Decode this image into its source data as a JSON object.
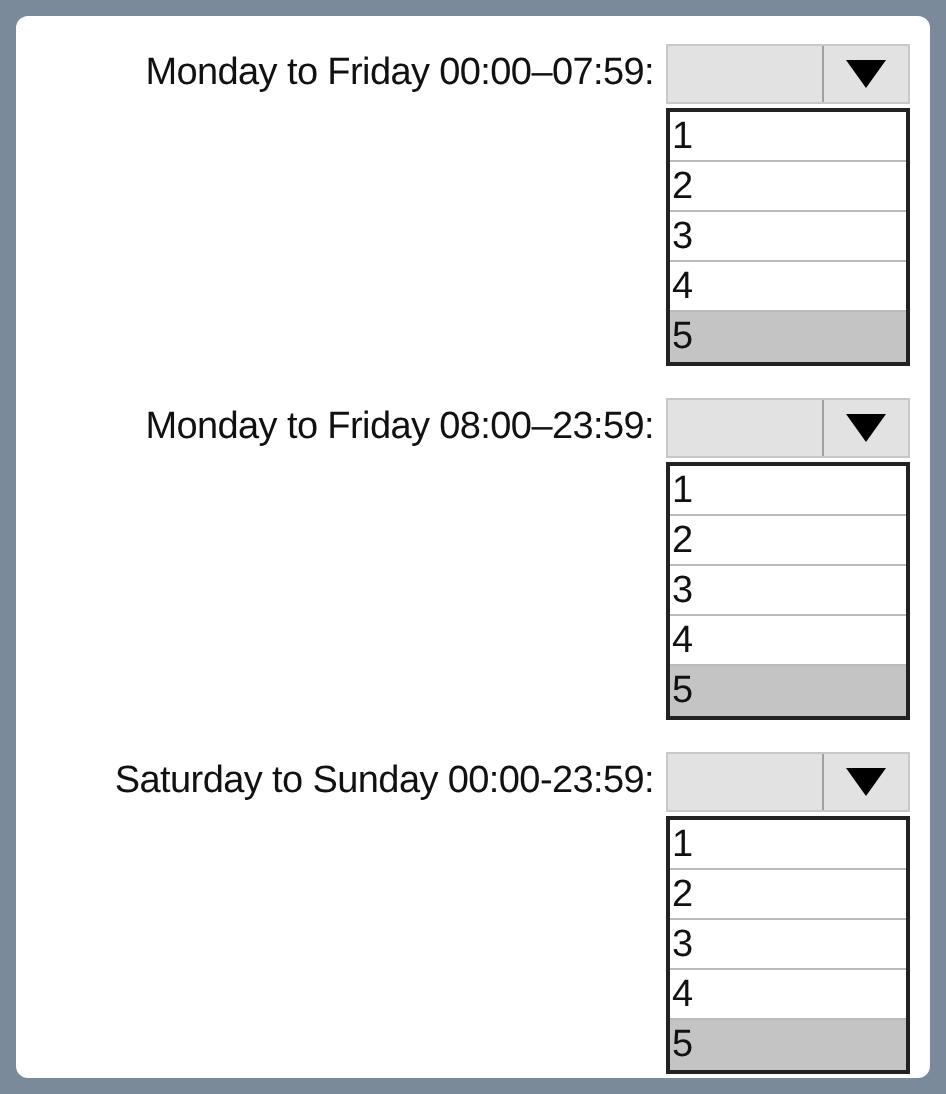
{
  "sections": [
    {
      "label": "Monday to Friday 00:00–07:59:",
      "options": [
        {
          "text": "1",
          "selected": false
        },
        {
          "text": "2",
          "selected": false
        },
        {
          "text": "3",
          "selected": false
        },
        {
          "text": "4",
          "selected": false
        },
        {
          "text": "5",
          "selected": true
        }
      ]
    },
    {
      "label": "Monday to Friday 08:00–23:59:",
      "options": [
        {
          "text": "1",
          "selected": false
        },
        {
          "text": "2",
          "selected": false
        },
        {
          "text": "3",
          "selected": false
        },
        {
          "text": "4",
          "selected": false
        },
        {
          "text": "5",
          "selected": true
        }
      ]
    },
    {
      "label": "Saturday to Sunday 00:00-23:59:",
      "options": [
        {
          "text": "1",
          "selected": false
        },
        {
          "text": "2",
          "selected": false
        },
        {
          "text": "3",
          "selected": false
        },
        {
          "text": "4",
          "selected": false
        },
        {
          "text": "5",
          "selected": true
        }
      ]
    }
  ]
}
